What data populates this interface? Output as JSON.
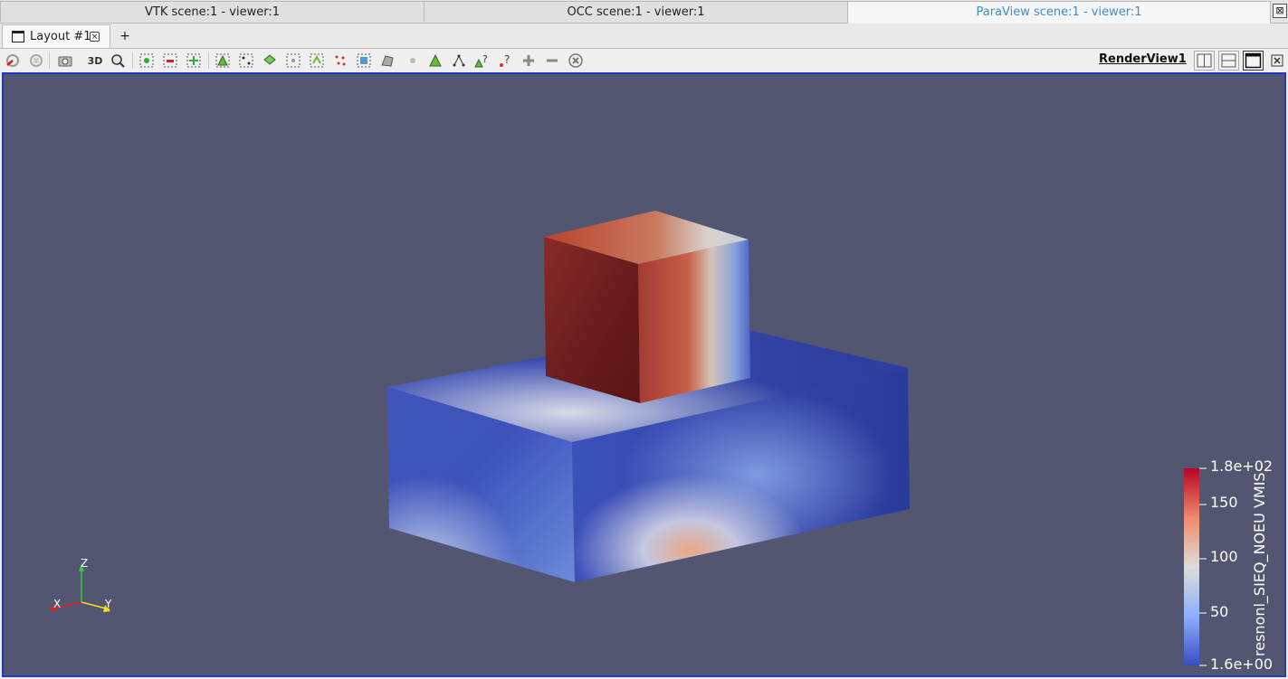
{
  "viewer_tabs": [
    {
      "label": "VTK scene:1 - viewer:1"
    },
    {
      "label": "OCC scene:1 - viewer:1"
    },
    {
      "label": "ParaView scene:1 - viewer:1"
    }
  ],
  "layout_tab": {
    "label": "Layout #1",
    "add_label": "+"
  },
  "toolbar": {
    "mode_label": "3D",
    "render_view_title": "RenderView1",
    "icons": [
      "reset-camera-icon",
      "reset-camera-closest-icon",
      "capture-screenshot-icon",
      "toggle-3d-icon",
      "zoom-to-box-icon",
      "select-cells-on-icon",
      "select-points-on-icon",
      "select-cells-through-icon",
      "select-points-through-icon",
      "select-cells-polygon-icon",
      "select-points-polygon-icon",
      "select-block-icon",
      "interactive-select-cells-icon",
      "interactive-select-points-icon",
      "hover-cells-icon",
      "hover-points-icon",
      "grow-selection-icon",
      "shrink-selection-icon",
      "clear-selection-icon",
      "plus-icon",
      "minus-icon",
      "close-circle-icon"
    ]
  },
  "render_view": {
    "background_color": "#535670",
    "border_color": "#1f39c8",
    "colorbar": {
      "title": "resnonl_SIEQ_NOEU VMIS",
      "max_label": "1.8e+02",
      "min_label": "1.6e+00",
      "ticks": [
        "150",
        "100",
        "50"
      ],
      "colors": [
        "#b40426",
        "#f08a6c",
        "#dddcdb",
        "#8db0fe",
        "#3b4cc0"
      ]
    },
    "orientation_axes": {
      "x": "X",
      "y": "Y",
      "z": "Z"
    }
  }
}
